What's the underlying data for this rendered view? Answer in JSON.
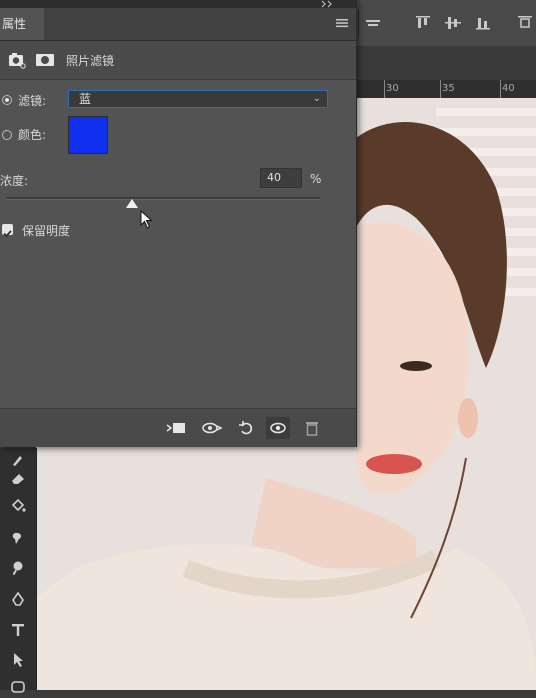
{
  "panel": {
    "tab_label": "属性",
    "section_title": "照片滤镜",
    "filter": {
      "label": "滤镜:",
      "value": "蓝",
      "selected": true
    },
    "color": {
      "label": "颜色:",
      "swatch": "#1030f0",
      "selected": false
    },
    "density": {
      "label": "浓度:",
      "value": "40",
      "unit": "%",
      "level_percent": 40
    },
    "preserve_luminosity": {
      "label": "保留明度",
      "checked": true
    }
  },
  "ruler": {
    "ticks": [
      "30",
      "35",
      "40"
    ]
  },
  "icons": {
    "top_options": [
      "align-center-icon",
      "align-top-icon",
      "align-vertical-center-icon",
      "align-bottom-icon",
      "distribute-icon"
    ],
    "footer": [
      "clip-to-layer-icon",
      "view-previous-state-icon",
      "reset-icon",
      "visibility-eye-icon",
      "delete-trash-icon"
    ],
    "tools": [
      "brush-icon",
      "eraser-icon",
      "paint-bucket-icon",
      "smudge-icon",
      "dodge-icon",
      "pen-icon",
      "text-tool-icon",
      "path-selection-icon",
      "shape-icon"
    ]
  }
}
